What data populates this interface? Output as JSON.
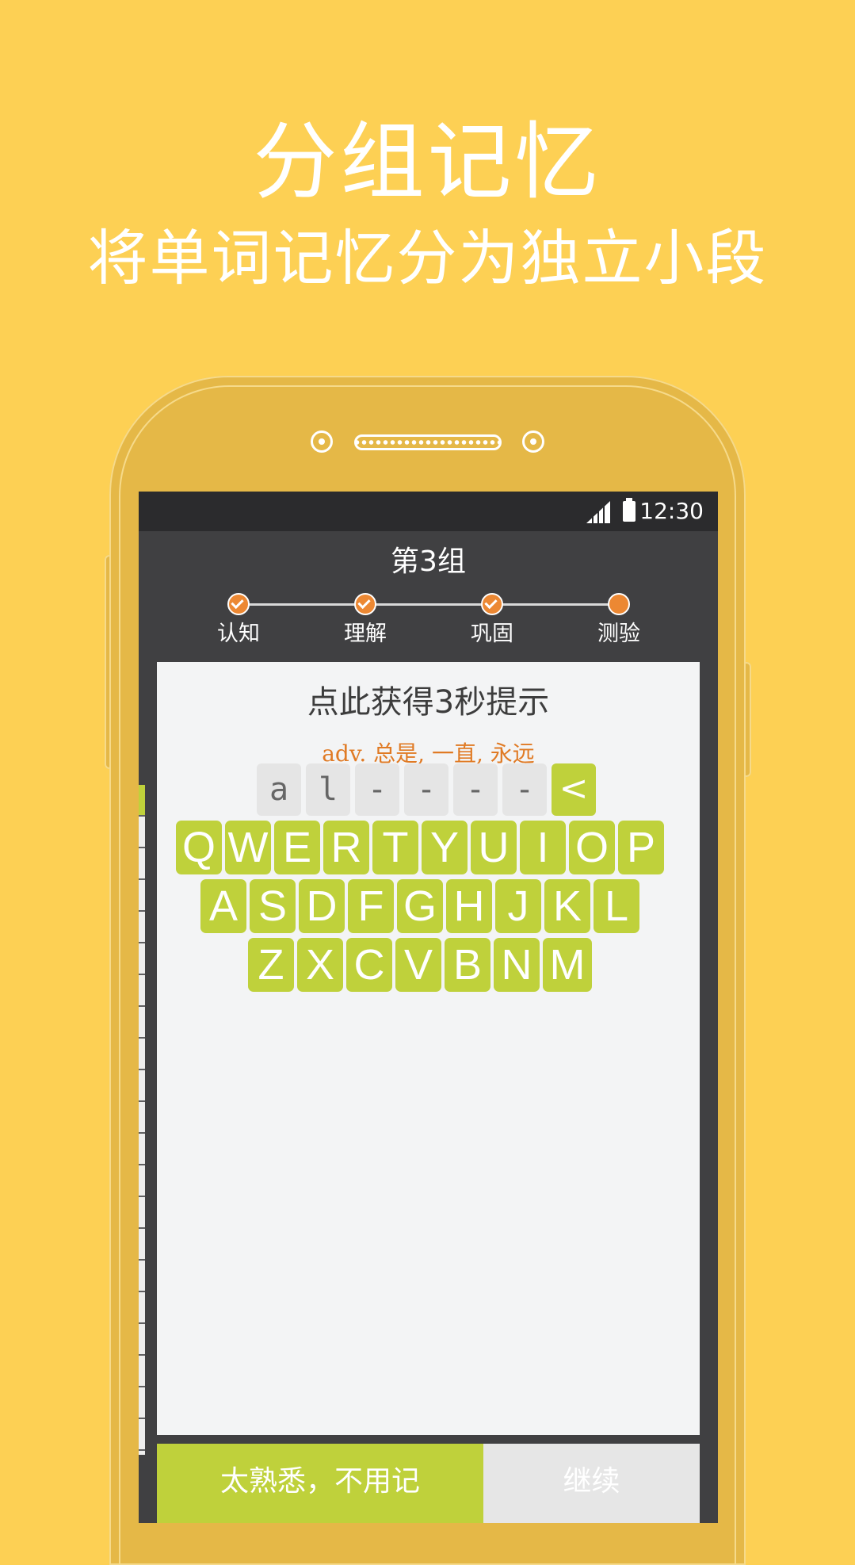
{
  "promo": {
    "title": "分组记忆",
    "subtitle": "将单词记忆分为独立小段"
  },
  "statusbar": {
    "time": "12:30"
  },
  "header": {
    "group_title": "第3组",
    "steps": [
      {
        "label": "认知",
        "state": "done"
      },
      {
        "label": "理解",
        "state": "done"
      },
      {
        "label": "巩固",
        "state": "done"
      },
      {
        "label": "测验",
        "state": "current"
      }
    ]
  },
  "quiz": {
    "hint": "点此获得3秒提示",
    "meaning": "adv. 总是, 一直, 永远",
    "answer_slots": [
      "a",
      "l",
      "-",
      "-",
      "-",
      "-"
    ],
    "backspace": "<"
  },
  "keyboard": {
    "row1": [
      "Q",
      "W",
      "E",
      "R",
      "T",
      "Y",
      "U",
      "I",
      "O",
      "P"
    ],
    "row2": [
      "A",
      "S",
      "D",
      "F",
      "G",
      "H",
      "J",
      "K",
      "L"
    ],
    "row3": [
      "Z",
      "X",
      "C",
      "V",
      "B",
      "N",
      "M"
    ]
  },
  "actions": {
    "known": "太熟悉，不用记",
    "continue": "继续"
  },
  "colors": {
    "background": "#FDD054",
    "phone_body": "#E5B847",
    "accent_green": "#BFD13B",
    "accent_orange": "#EC8833",
    "screen_dark": "#404042"
  }
}
